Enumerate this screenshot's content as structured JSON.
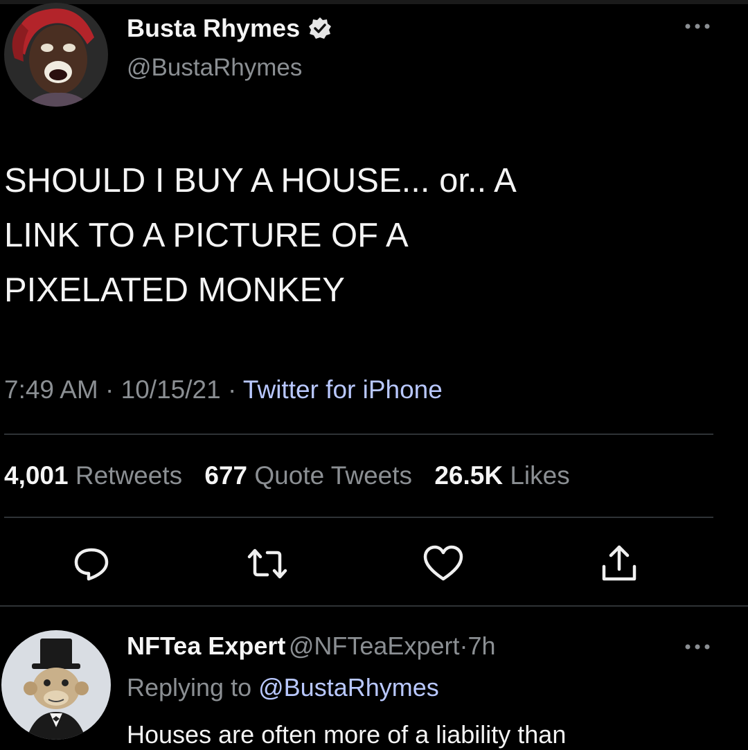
{
  "tweet": {
    "author": {
      "display_name": "Busta Rhymes",
      "handle": "@BustaRhymes",
      "verified": true,
      "avatar_icon": "profile-photo"
    },
    "text_lines": [
      "SHOULD I BUY A HOUSE... or.. A",
      "LINK TO A PICTURE OF A",
      "PIXELATED MONKEY"
    ],
    "time": "7:49 AM",
    "date": "10/15/21",
    "source": "Twitter for iPhone",
    "separator": "·",
    "stats": {
      "retweets_count": "4,001",
      "retweets_label": "Retweets",
      "quotes_count": "677",
      "quotes_label": "Quote Tweets",
      "likes_count": "26.5K",
      "likes_label": "Likes"
    },
    "more_icon": "more-dots-icon",
    "actions": [
      {
        "name": "reply",
        "icon": "comment-bubble-icon"
      },
      {
        "name": "retweet",
        "icon": "retweet-arrows-icon"
      },
      {
        "name": "like",
        "icon": "heart-icon"
      },
      {
        "name": "share",
        "icon": "share-upload-icon"
      }
    ]
  },
  "reply": {
    "author": {
      "display_name": "NFTea Expert",
      "handle": "@NFTeaExpert",
      "time": "7h",
      "avatar_icon": "cartoon-ape-avatar"
    },
    "replying_to_label": "Replying to",
    "replying_to_handle": "@BustaRhymes",
    "text": "Houses are often more of a liability than"
  },
  "colors": {
    "background": "#000000",
    "primary_text": "#f4f4f4",
    "secondary_text": "#8b8f93",
    "link": "#b9c8ff",
    "divider": "#2f3336"
  }
}
